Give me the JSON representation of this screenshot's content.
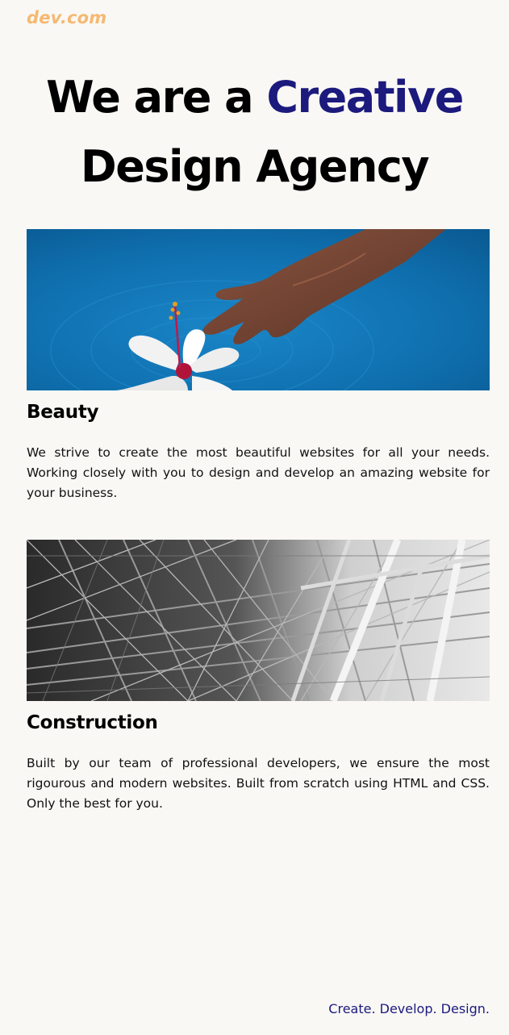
{
  "brand": {
    "logo_text": "dev.com",
    "logo_color": "#f5b971"
  },
  "hero": {
    "line1_prefix": "We are a ",
    "line1_accent": "Creative",
    "line2": "Design Agency",
    "accent_color": "#1c1a7d"
  },
  "cards": [
    {
      "title": "Beauty",
      "image": "hand-touching-water-with-hibiscus-flower",
      "text": "We strive to create the most beautiful websites for all your needs. Working closely with you to design and develop an amazing website for your business."
    },
    {
      "title": "Construction",
      "image": "steel-lattice-structure-black-and-white",
      "text": "Built by our team of professional developers, we ensure the most rigourous and modern websites. Built from scratch using HTML and CSS. Only the best for you."
    }
  ],
  "footer": {
    "tagline": "Create. Develop. Design."
  },
  "colors": {
    "background": "#f9f8f5",
    "text": "#000000",
    "accent": "#1c1a7d"
  }
}
